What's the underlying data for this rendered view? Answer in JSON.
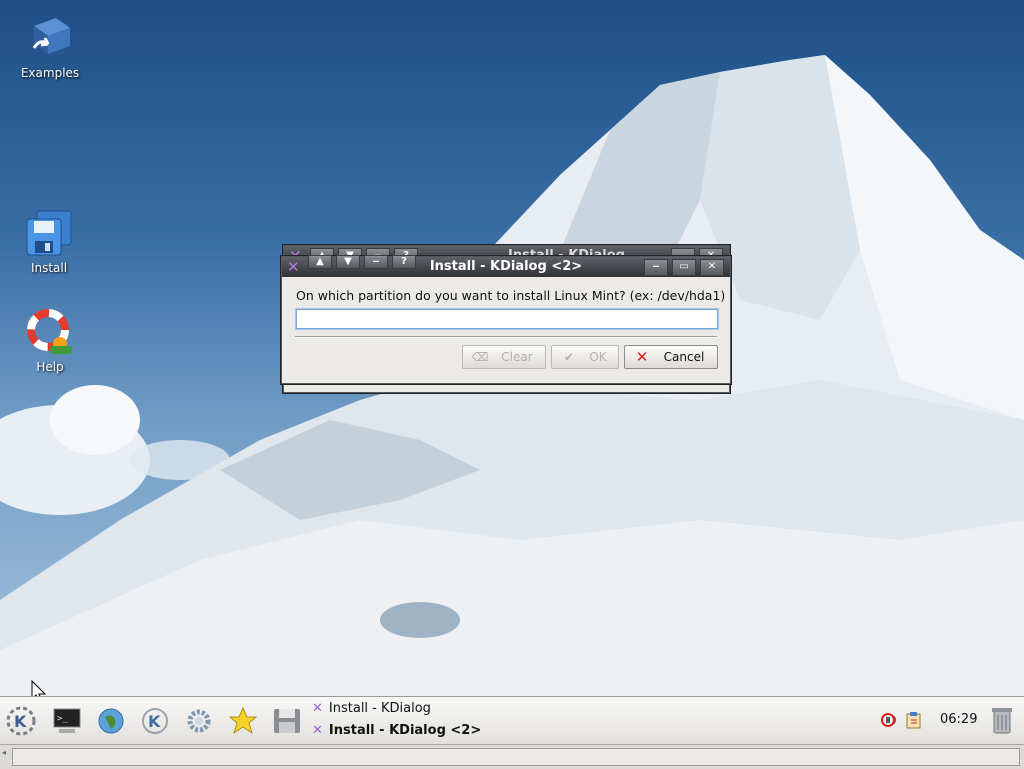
{
  "desktop": {
    "icons": [
      {
        "label": "Examples",
        "icon": "folder-book-icon"
      },
      {
        "label": "Install",
        "icon": "floppy-install-icon"
      },
      {
        "label": "Help",
        "icon": "lifebuoy-help-icon"
      }
    ]
  },
  "back_window": {
    "title": "Install - KDialog"
  },
  "dialog": {
    "title": "Install - KDialog <2>",
    "prompt": "On which partition do you want to install Linux Mint? (ex: /dev/hda1)",
    "input_value": "",
    "buttons": {
      "clear": "Clear",
      "ok": "OK",
      "cancel": "Cancel"
    },
    "title_buttons": [
      "^",
      "v",
      "_",
      "?"
    ],
    "window_controls": [
      "minimize",
      "maximize",
      "close"
    ]
  },
  "taskbar": {
    "launchers": [
      "kde-menu-icon",
      "terminal-icon",
      "browser-globe-icon",
      "konqueror-icon",
      "settings-gear-icon",
      "bookmark-star-icon",
      "floppy-icon"
    ],
    "tasks": [
      {
        "label": "Install - KDialog",
        "active": false
      },
      {
        "label": "Install - KDialog <2>",
        "active": true
      }
    ],
    "clock": "06:29",
    "tray": [
      "speaker-muted-icon",
      "klipper-icon"
    ]
  },
  "colors": {
    "accent": "#7aa6d6",
    "window_title_bg": "#3b3d41",
    "cancel_x": "#d9201f"
  }
}
